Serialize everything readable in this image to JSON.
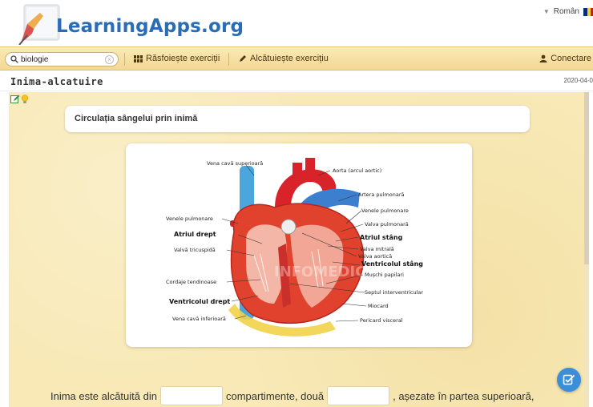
{
  "header": {
    "logo_text": "LearningApps.org",
    "language_label": "Român",
    "flag_colors": [
      "#002b7f",
      "#fcd116",
      "#ce1126"
    ]
  },
  "nav": {
    "search_value": "biologie",
    "browse_label": "Răsfoiește exerciții",
    "create_label": "Alcătuiește exercițiu",
    "login_label": "Conectare"
  },
  "page": {
    "title": "Inima-alcatuire",
    "date": "2020-04-0"
  },
  "exercise": {
    "question_title": "Circulația sângelui prin inimă",
    "sentence_part1": "Inima este alcătuită din",
    "sentence_part2": "compartimente, două",
    "sentence_part3": ", așezate în partea superioară,"
  },
  "diagram": {
    "labels": {
      "vena_cava_sup": "Vena cavă superioară",
      "aorta": "Aorta (arcul aortic)",
      "artera_pulm": "Artera pulmonară",
      "venele_pulm_r": "Venele pulmonare",
      "venele_pulm_l": "Venele pulmonare",
      "valva_pulm": "Valva pulmonară",
      "atriul_drept": "Atriul drept",
      "atriul_stang": "Atriul stâng",
      "valva_tricusp": "Valvă tricuspidă",
      "valva_mitrala": "Valva mitrală",
      "valva_aortica": "Valva aortică",
      "ventr_stang": "Ventricolul stâng",
      "muschi_pap": "Mușchi papilari",
      "cordaje": "Cordaje tendinoase",
      "septul": "Septul interventricular",
      "ventr_drept": "Ventricolul drept",
      "miocard": "Miocard",
      "vena_cava_inf": "Vena cavă inferioară",
      "pericard": "Pericard visceral",
      "watermark": "INFOMEDIC"
    }
  },
  "colors": {
    "nav_bg": "#f3d896",
    "app_bg": "#f8e9b6",
    "logo_blue": "#2a6db7",
    "check_button": "#3b8fd9"
  }
}
